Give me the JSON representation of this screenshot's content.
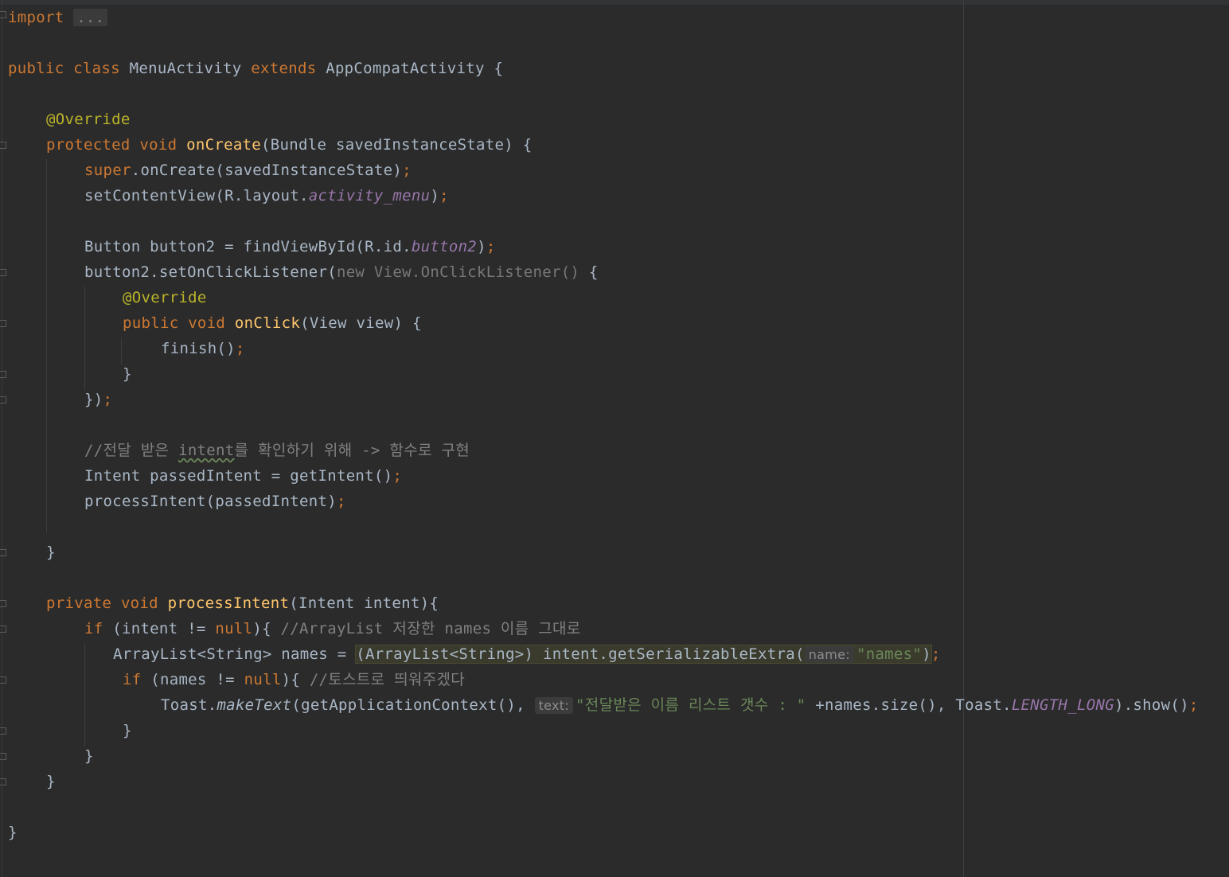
{
  "editor": {
    "l1_import_kw": "import",
    "l1_folded": "...",
    "l2_public": "public",
    "l2_class": "class",
    "l2_name": "MenuActivity",
    "l2_extends": "extends",
    "l2_parent": "AppCompatActivity {",
    "l3_ann": "@Override",
    "l4_protected": "protected",
    "l4_void": "void",
    "l4_fn": "onCreate",
    "l4_rest": "(Bundle savedInstanceState) {",
    "l5_super": "super",
    "l5_rest": ".onCreate(savedInstanceState)",
    "semi": ";",
    "l6_a": "setContentView(R.layout.",
    "l6_field": "activity_menu",
    "l6_b": ")",
    "l7_a": "Button button2 = findViewById(R.id.",
    "l7_field": "button2",
    "l7_b": ")",
    "l8_a": "button2.setOnClickListener(",
    "l8_new": "new View.OnClickListener()",
    "l8_b": " {",
    "l9_ann": "@Override",
    "l10_public": "public",
    "l10_void": "void",
    "l10_fn": "onClick",
    "l10_rest": "(View view) {",
    "l11_a": "finish()",
    "l12": "}",
    "l13_a": "})",
    "l14_a": "//전달 받은 ",
    "l14_intent": "intent",
    "l14_b": "를 확인하기 위해 -> 함수로 구현",
    "l15_a": "Intent passedIntent = getIntent()",
    "l16_a": "processIntent(passedIntent)",
    "l17": "}",
    "l18_private": "private",
    "l18_void": "void",
    "l18_fn": "processIntent",
    "l18_rest": "(Intent intent){",
    "l19_if": "if",
    "l19_a": " (intent != ",
    "l19_null": "null",
    "l19_b": "){ ",
    "l19_cmt": "//ArrayList 저장한 names 이름 그대로",
    "l20_a": "ArrayList<String> names = ",
    "l20_hl": "(ArrayList<String>) intent.getSerializableExtra(",
    "l20_hint": "name:",
    "l20_str": "\"names\"",
    "l20_b": ")",
    "l21_if": "if",
    "l21_a": " (names != ",
    "l21_null": "null",
    "l21_b": "){ ",
    "l21_cmt": "//토스트로 띄워주겠다",
    "l22_a": "Toast.",
    "l22_make": "makeText",
    "l22_b": "(getApplicationContext(), ",
    "l22_hint": "text:",
    "l22_str": "\"전달받은 이름 리스트 갯수 : \"",
    "l22_c": " +names.size(), Toast.",
    "l22_field": "LENGTH_LONG",
    "l22_d": ").show()",
    "l23": "}",
    "l24": "}",
    "l25": "}",
    "l26": "}"
  }
}
